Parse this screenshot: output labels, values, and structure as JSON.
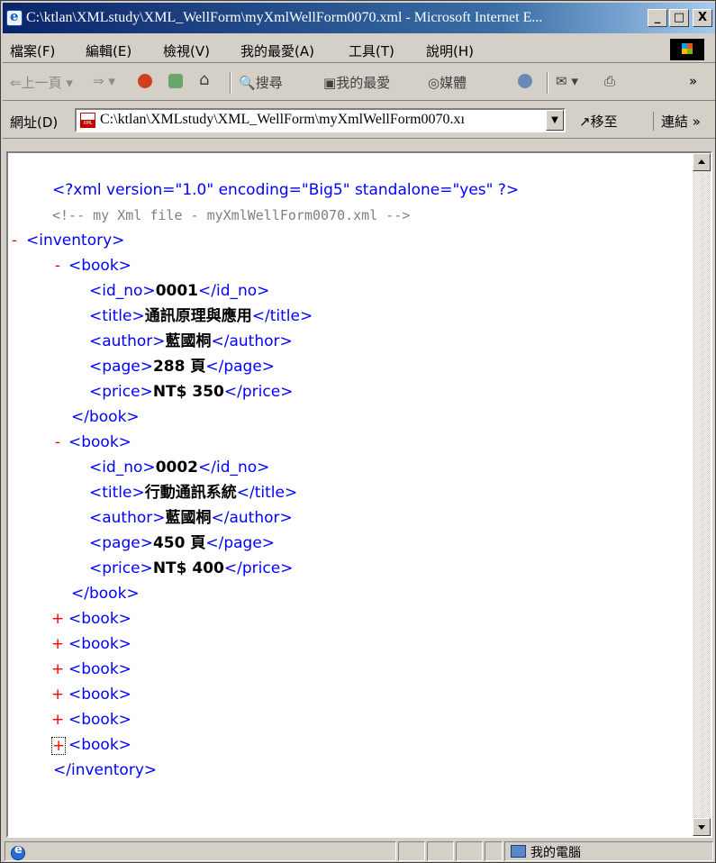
{
  "window": {
    "title": "C:\\ktlan\\XMLstudy\\XML_WellForm\\myXmlWellForm0070.xml - Microsoft Internet E...",
    "buttons": {
      "minimize": "_",
      "maximize": "□",
      "close": "X"
    }
  },
  "menu": [
    "檔案(F)",
    "編輯(E)",
    "檢視(V)",
    "我的最愛(A)",
    "工具(T)",
    "說明(H)"
  ],
  "toolbar": {
    "back": "⇐上一頁",
    "forward": "⇒",
    "stop_icon": "stop-icon",
    "refresh_icon": "refresh-icon",
    "home_icon": "home-icon",
    "search": "搜尋",
    "favorites": "我的最愛",
    "media": "媒體",
    "overflow": "»"
  },
  "address": {
    "label": "網址(D)",
    "value": "C:\\ktlan\\XMLstudy\\XML_WellForm\\myXmlWellForm0070.xı",
    "go": "移至",
    "links": "連結 »"
  },
  "xml": {
    "pi": "<?xml version=\"1.0\" encoding=\"Big5\" standalone=\"yes\" ?>",
    "comment": "<!--      my Xml file - myXmlWellForm0070.xml    -->",
    "root_open": "<inventory>",
    "root_close": "</inventory>",
    "book_open": "<book>",
    "book_close": "</book>",
    "books": [
      {
        "id_no": "0001",
        "title": "通訊原理與應用",
        "author": "藍國桐",
        "page": "288 頁",
        "price": "NT$ 350"
      },
      {
        "id_no": "0002",
        "title": "行動通訊系統",
        "author": "藍國桐",
        "page": "450 頁",
        "price": "NT$ 400"
      }
    ],
    "tags": {
      "id_no_open": "<id_no>",
      "id_no_close": "</id_no>",
      "title_open": "<title>",
      "title_close": "</title>",
      "author_open": "<author>",
      "author_close": "</author>",
      "page_open": "<page>",
      "page_close": "</page>",
      "price_open": "<price>",
      "price_close": "</price>"
    },
    "collapsed_books_count": 6,
    "expand_symbol": "-",
    "collapse_symbol": "+"
  },
  "status": {
    "zone": "我的電腦"
  }
}
